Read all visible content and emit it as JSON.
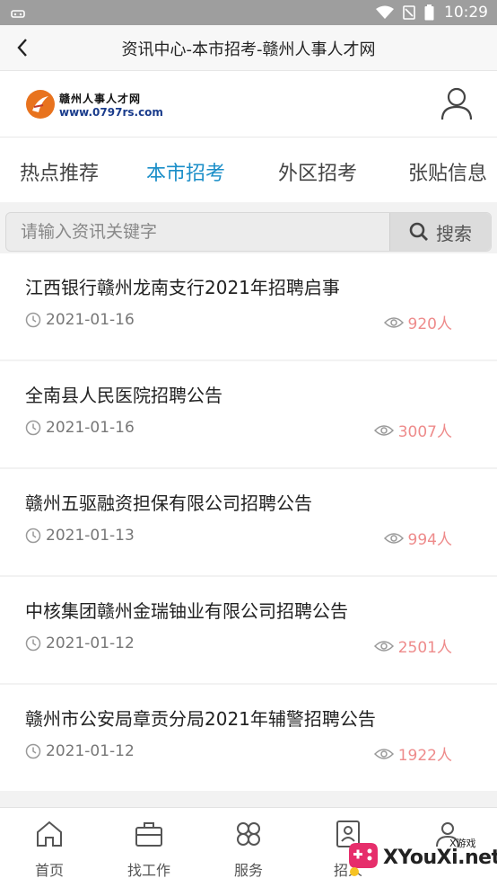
{
  "status_bar": {
    "time": "10:29"
  },
  "title_bar": {
    "title": "资讯中心-本市招考-赣州人事人才网"
  },
  "header": {
    "logo": {
      "name": "赣州人事人才网",
      "url": "www.0797rs.com"
    }
  },
  "tabs": [
    {
      "label": "热点推荐",
      "active": false
    },
    {
      "label": "本市招考",
      "active": true
    },
    {
      "label": "外区招考",
      "active": false
    },
    {
      "label": "张贴信息",
      "active": false
    }
  ],
  "search": {
    "placeholder": "请输入资讯关键字",
    "value": "",
    "button_label": "搜索"
  },
  "news": [
    {
      "title": "江西银行赣州龙南支行2021年招聘启事",
      "date": "2021-01-16",
      "views": "920人"
    },
    {
      "title": "全南县人民医院招聘公告",
      "date": "2021-01-16",
      "views": "3007人"
    },
    {
      "title": "赣州五驱融资担保有限公司招聘公告",
      "date": "2021-01-13",
      "views": "994人"
    },
    {
      "title": "中核集团赣州金瑞铀业有限公司招聘公告",
      "date": "2021-01-12",
      "views": "2501人"
    },
    {
      "title": "赣州市公安局章贡分局2021年辅警招聘公告",
      "date": "2021-01-12",
      "views": "1922人"
    }
  ],
  "bottom_nav": [
    {
      "label": "首页",
      "icon": "home-icon"
    },
    {
      "label": "找工作",
      "icon": "briefcase-icon"
    },
    {
      "label": "服务",
      "icon": "clover-icon"
    },
    {
      "label": "招人",
      "icon": "resume-icon"
    },
    {
      "label": "",
      "icon": "user-icon"
    }
  ],
  "watermark": {
    "text": "XYouXi.net",
    "small": "X游戏"
  },
  "colors": {
    "accent": "#1a8ec8",
    "views": "#ee8b8b"
  }
}
